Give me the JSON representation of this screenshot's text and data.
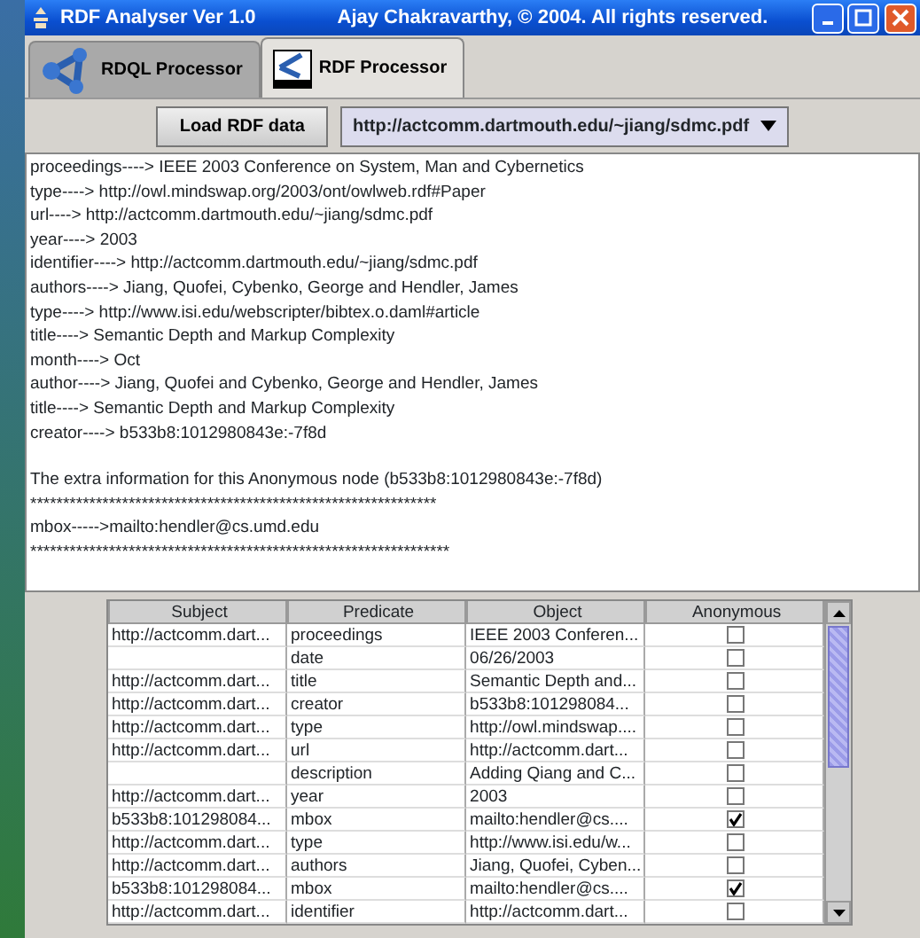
{
  "window": {
    "title": "RDF Analyser Ver 1.0",
    "subtitle": "Ajay Chakravarthy, © 2004. All rights reserved."
  },
  "tabs": [
    {
      "label": "RDQL Processor",
      "selected": false
    },
    {
      "label": "RDF Processor",
      "selected": true
    }
  ],
  "toolbar": {
    "load_button": "Load RDF data",
    "url_dropdown": "http://actcomm.dartmouth.edu/~jiang/sdmc.pdf"
  },
  "output_blocks": [
    [
      "proceedings----> IEEE 2003 Conference on System, Man and Cybernetics",
      "type----> http://owl.mindswap.org/2003/ont/owlweb.rdf#Paper",
      "url----> http://actcomm.dartmouth.edu/~jiang/sdmc.pdf",
      "year----> 2003",
      "identifier----> http://actcomm.dartmouth.edu/~jiang/sdmc.pdf",
      "authors----> Jiang, Quofei, Cybenko, George and Hendler, James",
      "type----> http://www.isi.edu/webscripter/bibtex.o.daml#article",
      "title----> Semantic Depth and Markup Complexity",
      "month----> Oct",
      "author----> Jiang, Quofei and Cybenko, George and Hendler, James",
      "title----> Semantic Depth and Markup Complexity",
      "creator----> b533b8:1012980843e:-7f8d"
    ],
    [
      "The extra information for this Anonymous node (b533b8:1012980843e:-7f8d)",
      "**************************************************************",
      "mbox----->mailto:hendler@cs.umd.edu",
      "****************************************************************"
    ]
  ],
  "table": {
    "columns": [
      "Subject",
      "Predicate",
      "Object",
      "Anonymous"
    ],
    "rows": [
      {
        "subject": "http://actcomm.dart...",
        "predicate": "proceedings",
        "object": "IEEE 2003 Conferen...",
        "anonymous": false
      },
      {
        "predicate": "date",
        "object": "06/26/2003",
        "anonymous": false
      },
      {
        "subject": "http://actcomm.dart...",
        "predicate": "title",
        "object": "Semantic Depth and...",
        "anonymous": false
      },
      {
        "subject": "http://actcomm.dart...",
        "predicate": "creator",
        "object": "b533b8:101298084...",
        "anonymous": false
      },
      {
        "subject": "http://actcomm.dart...",
        "predicate": "type",
        "object": "http://owl.mindswap....",
        "anonymous": false
      },
      {
        "subject": "http://actcomm.dart...",
        "predicate": "url",
        "object": "http://actcomm.dart...",
        "anonymous": false
      },
      {
        "predicate": "description",
        "object": "Adding Qiang and C...",
        "anonymous": false
      },
      {
        "subject": "http://actcomm.dart...",
        "predicate": "year",
        "object": "2003",
        "anonymous": false
      },
      {
        "subject": "b533b8:101298084...",
        "predicate": "mbox",
        "object": "mailto:hendler@cs....",
        "anonymous": true
      },
      {
        "subject": "http://actcomm.dart...",
        "predicate": "type",
        "object": "http://www.isi.edu/w...",
        "anonymous": false
      },
      {
        "subject": "http://actcomm.dart...",
        "predicate": "authors",
        "object": "Jiang, Quofei, Cyben...",
        "anonymous": false
      },
      {
        "subject": "b533b8:101298084...",
        "predicate": "mbox",
        "object": "mailto:hendler@cs....",
        "anonymous": true
      },
      {
        "subject": "http://actcomm.dart...",
        "predicate": "identifier",
        "object": "http://actcomm.dart...",
        "anonymous": false
      }
    ]
  }
}
